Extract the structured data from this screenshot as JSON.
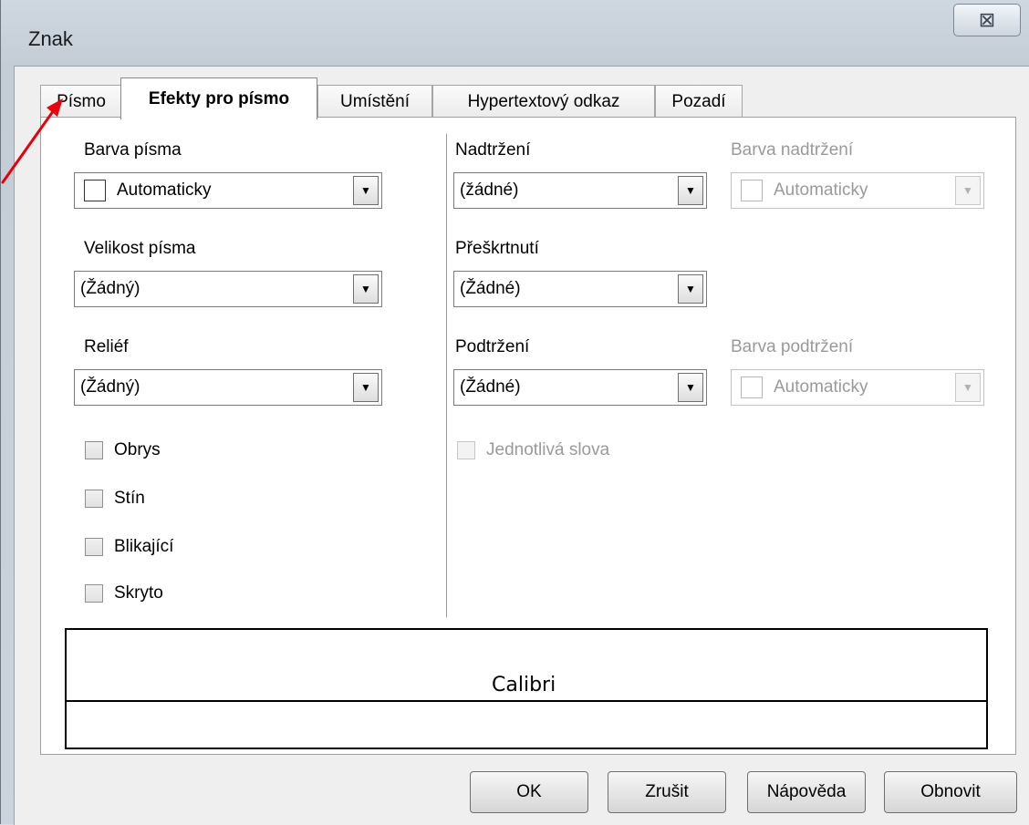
{
  "window": {
    "title": "Znak",
    "close_glyph": "⊠"
  },
  "tabs": [
    {
      "label": "Písmo"
    },
    {
      "label": "Efekty pro písmo",
      "active": true
    },
    {
      "label": "Umístění"
    },
    {
      "label": "Hypertextový odkaz"
    },
    {
      "label": "Pozadí"
    }
  ],
  "left": {
    "font_color_label": "Barva písma",
    "font_color_value": "Automaticky",
    "font_size_label": "Velikost písma",
    "font_size_value": "(Žádný)",
    "relief_label": "Reliéf",
    "relief_value": "(Žádný)",
    "checkboxes": [
      "Obrys",
      "Stín",
      "Blikající",
      "Skryto"
    ]
  },
  "right": {
    "overline_label": "Nadtržení",
    "overline_value": "(žádné)",
    "overline_color_label": "Barva nadtržení",
    "overline_color_value": "Automaticky",
    "strikethrough_label": "Přeškrtnutí",
    "strikethrough_value": "(Žádné)",
    "underline_label": "Podtržení",
    "underline_value": "(Žádné)",
    "underline_color_label": "Barva podtržení",
    "underline_color_value": "Automaticky",
    "individual_words_label": "Jednotlivá slova"
  },
  "preview": {
    "text": "Calibri"
  },
  "buttons": {
    "ok": "OK",
    "cancel": "Zrušit",
    "help": "Nápověda",
    "reset": "Obnovit"
  },
  "annotation": {
    "color": "#e8000b"
  },
  "icons": {
    "dropdown": "triangle-down",
    "close": "close-x"
  }
}
